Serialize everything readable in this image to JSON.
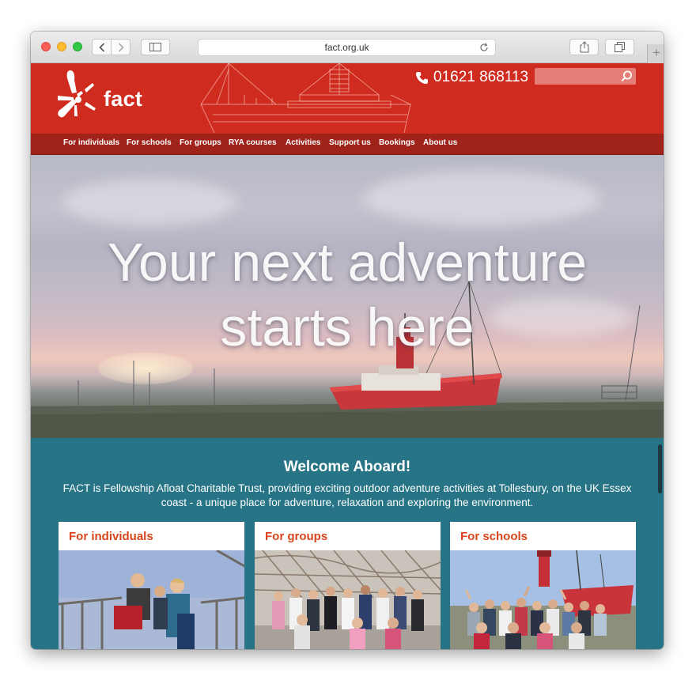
{
  "browser": {
    "url": "fact.org.uk",
    "icons": [
      "back-icon",
      "forward-icon",
      "sidebar-icon",
      "reload-icon",
      "share-icon",
      "tabs-icon",
      "new-tab-icon"
    ]
  },
  "header": {
    "logo_text": "fact",
    "phone": "01621 868113",
    "search_placeholder": "",
    "brand_color": "#cf2b1f",
    "nav_color": "#9f231b"
  },
  "nav": {
    "items": [
      {
        "label": "For individuals"
      },
      {
        "label": "For schools"
      },
      {
        "label": "For groups"
      },
      {
        "label": "RYA courses"
      },
      {
        "label": "Activities"
      },
      {
        "label": "Support us"
      },
      {
        "label": "Bookings"
      },
      {
        "label": "About us"
      }
    ]
  },
  "hero": {
    "line1": "Your next adventure",
    "line2": "starts here"
  },
  "welcome": {
    "title": "Welcome Aboard!",
    "line1": "FACT is Fellowship Afloat Charitable Trust, providing exciting outdoor adventure activities at Tollesbury, on the UK Essex",
    "line2": "coast - a unique place for adventure, relaxation and exploring the environment.",
    "background": "#267485",
    "accent": "#d8451a"
  },
  "cards": [
    {
      "title": "For individuals"
    },
    {
      "title": "For groups"
    },
    {
      "title": "For schools"
    }
  ]
}
